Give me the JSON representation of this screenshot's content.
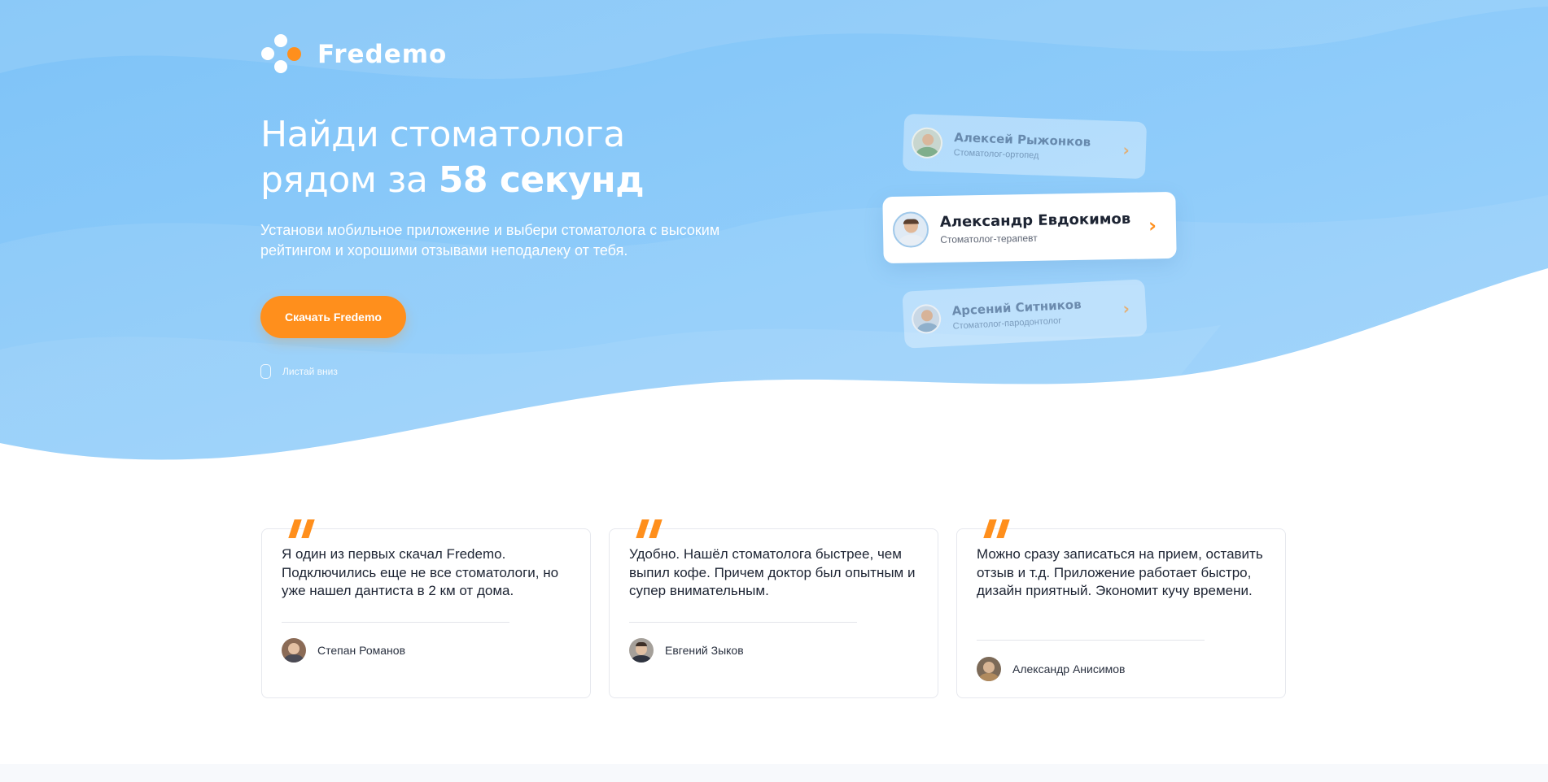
{
  "brand": {
    "name": "Fredemo",
    "accent": "#ff8f1c",
    "sky": "#8ccaf9"
  },
  "hero": {
    "title_line1": "Найди стоматолога",
    "title_line2_prefix": "рядом за ",
    "title_line2_bold": "58 секунд",
    "subtitle": "Установи мобильное приложение и выбери стоматолога с высоким рейтингом и хорошими отзывами неподалеку от тебя.",
    "cta_label": "Скачать Fredemo",
    "scroll_hint": "Листай вниз"
  },
  "doctors": [
    {
      "name": "Алексей Рыжонков",
      "role": "Стоматолог-ортопед",
      "chevron": "›"
    },
    {
      "name": "Александр Евдокимов",
      "role": "Стоматолог-терапевт",
      "chevron": "›"
    },
    {
      "name": "Арсений Ситников",
      "role": "Стоматолог-пародонтолог",
      "chevron": "›"
    }
  ],
  "reviews": [
    {
      "text": "Я один из первых скачал Fredemo. Подключились еще не все стоматологи, но уже нашел дантиста в 2 км от дома.",
      "author": "Степан Романов"
    },
    {
      "text": "Удобно. Нашёл стоматолога быстрее, чем выпил кофе. Причем доктор был опытным и супер внимательным.",
      "author": "Евгений Зыков"
    },
    {
      "text": "Можно сразу записаться на прием, оставить отзыв и т.д. Приложение работает быстро, дизайн приятный. Экономит кучу времени.",
      "author": "Александр Анисимов"
    }
  ]
}
